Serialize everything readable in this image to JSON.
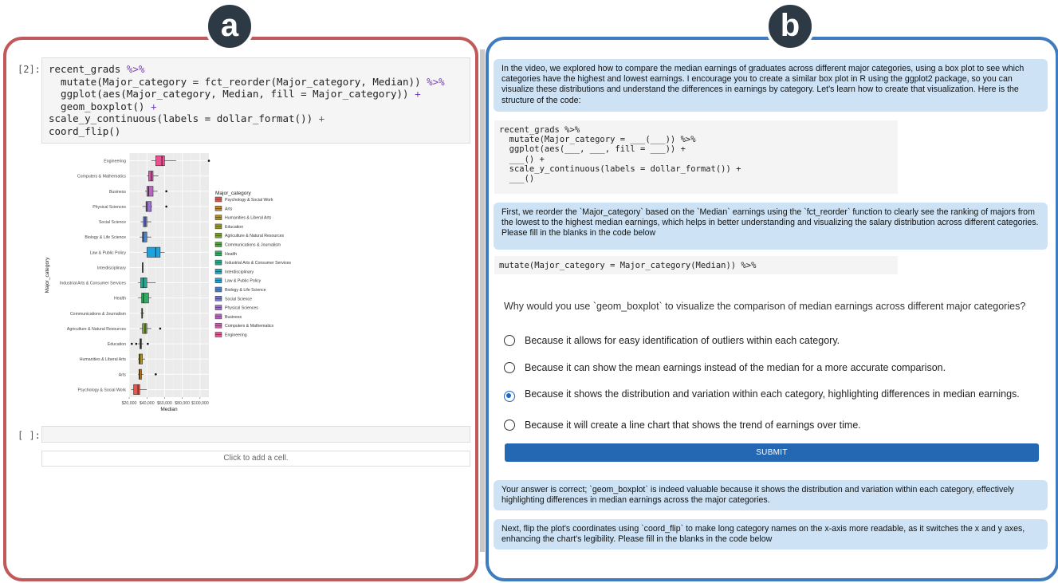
{
  "badges": {
    "a": "a",
    "b": "b"
  },
  "notebook": {
    "cell1_prompt": "[2]:",
    "cell1_lines": [
      {
        "text": "recent_grads ",
        "op": "%>%"
      },
      {
        "text": "  mutate(Major_category = fct_reorder(Major_category, Median)) ",
        "op": "%>%"
      },
      {
        "text": "  ggplot(aes(Major_category, Median, fill = Major_category)) ",
        "op": "+"
      },
      {
        "text": "  geom_boxplot() ",
        "op": "+"
      },
      {
        "text": "scale_y_continuous(labels = dollar_format()) ",
        "op": "+"
      },
      {
        "text": "coord_flip()",
        "op": ""
      }
    ],
    "cell2_prompt": "[ ]:",
    "add_cell_label": "Click to add a cell."
  },
  "chart_data": {
    "type": "box",
    "xlabel": "Median",
    "ylabel": "Major_category",
    "xlim": [
      20000,
      110000
    ],
    "x_ticks": [
      "$20,000",
      "$40,000",
      "$60,000",
      "$80,000",
      "$100,000"
    ],
    "x_tick_values": [
      20000,
      40000,
      60000,
      80000,
      100000
    ],
    "legend_title": "Major_category",
    "legend_position": "right",
    "grid": true,
    "categories": [
      {
        "name": "Engineering",
        "color": "#ee4f8f",
        "min": 45000,
        "q1": 50000,
        "median": 57000,
        "q3": 60000,
        "max": 73000,
        "outliers": [
          110000
        ]
      },
      {
        "name": "Computers & Mathematics",
        "color": "#d85bb0",
        "min": 40000,
        "q1": 42000,
        "median": 45000,
        "q3": 47000,
        "max": 53000,
        "outliers": []
      },
      {
        "name": "Business",
        "color": "#bf62c4",
        "min": 38000,
        "q1": 40000,
        "median": 42000,
        "q3": 47000,
        "max": 52000,
        "outliers": [
          62000
        ]
      },
      {
        "name": "Physical Sciences",
        "color": "#9c6ed3",
        "min": 35000,
        "q1": 39000,
        "median": 40000,
        "q3": 45000,
        "max": 46000,
        "outliers": [
          62000
        ]
      },
      {
        "name": "Social Science",
        "color": "#6f78d8",
        "min": 33000,
        "q1": 36000,
        "median": 38000,
        "q3": 40000,
        "max": 45000,
        "outliers": []
      },
      {
        "name": "Biology & Life Science",
        "color": "#4a84d4",
        "min": 32000,
        "q1": 35000,
        "median": 36000,
        "q3": 40000,
        "max": 45000,
        "outliers": []
      },
      {
        "name": "Law & Public Policy",
        "color": "#1fa3dc",
        "min": 36000,
        "q1": 40000,
        "median": 50000,
        "q3": 55000,
        "max": 60000,
        "outliers": []
      },
      {
        "name": "Interdisciplinary",
        "color": "#21a8bd",
        "min": 35000,
        "q1": 35000,
        "median": 35000,
        "q3": 35000,
        "max": 35000,
        "outliers": []
      },
      {
        "name": "Industrial Arts & Consumer Services",
        "color": "#1ead92",
        "min": 30000,
        "q1": 33000,
        "median": 36000,
        "q3": 40000,
        "max": 50000,
        "outliers": []
      },
      {
        "name": "Health",
        "color": "#2fae63",
        "min": 30000,
        "q1": 34000,
        "median": 36000,
        "q3": 42000,
        "max": 45000,
        "outliers": []
      },
      {
        "name": "Communications & Journalism",
        "color": "#4fa93a",
        "min": 33000,
        "q1": 34000,
        "median": 35000,
        "q3": 35000,
        "max": 37000,
        "outliers": []
      },
      {
        "name": "Agriculture & Natural Resources",
        "color": "#78a328",
        "min": 32000,
        "q1": 35000,
        "median": 38000,
        "q3": 40000,
        "max": 45000,
        "outliers": [
          55000
        ]
      },
      {
        "name": "Education",
        "color": "#939b1e",
        "min": 30000,
        "q1": 32000,
        "median": 33000,
        "q3": 34000,
        "max": 36000,
        "outliers": [
          23000,
          28000,
          41000
        ]
      },
      {
        "name": "Humanities & Liberal Arts",
        "color": "#ab9220",
        "min": 30000,
        "q1": 31000,
        "median": 32000,
        "q3": 35000,
        "max": 38000,
        "outliers": []
      },
      {
        "name": "Arts",
        "color": "#c48530",
        "min": 30000,
        "q1": 31000,
        "median": 32000,
        "q3": 34000,
        "max": 36000,
        "outliers": [
          50000
        ]
      },
      {
        "name": "Psychology & Social Work",
        "color": "#e2584f",
        "min": 22000,
        "q1": 25000,
        "median": 30000,
        "q3": 32000,
        "max": 40000,
        "outliers": []
      }
    ]
  },
  "chat": {
    "intro": "In the video, we explored how to compare the median earnings of graduates across different major categories, using a box plot to see which categories have the highest and lowest earnings. I encourage you to create a similar box plot in R using the ggplot2 package, so you can visualize these distributions and understand the differences in earnings by category. Let's learn how to create that visualization. Here is the structure of the code:",
    "code_template": "recent_grads %>%\n  mutate(Major_category = ___(___)) %>%\n  ggplot(aes(___, ___, fill = ___)) +\n  ___() +\n  scale_y_continuous(labels = dollar_format()) +\n  ___()",
    "step1": "First, we reorder the `Major_category` based on the `Median` earnings using the `fct_reorder` function to clearly see the ranking of majors from the lowest to the highest median earnings, which helps in better understanding and visualizing the salary distribution across different categories. Please fill in the blanks in the code below",
    "step1_code": "mutate(Major_category = Major_category(Median)) %>%",
    "question": "Why would you use `geom_boxplot` to visualize the comparison of median earnings across different major categories?",
    "options": [
      "Because it allows for easy identification of outliers within each category.",
      "Because it can show the mean earnings instead of the median for a more accurate comparison.",
      "Because it shows the distribution and variation within each category, highlighting differences in median earnings.",
      "Because it will create a line chart that shows the trend of earnings over time."
    ],
    "selected_option": 2,
    "submit_label": "SUBMIT",
    "feedback": "Your answer is correct; `geom_boxplot` is indeed valuable because it shows the distribution and variation within each category, effectively highlighting differences in median earnings across the major categories.",
    "step2": "Next, flip the plot's coordinates using `coord_flip` to make long category names on the x-axis more readable, as it switches the x and y axes, enhancing the chart's legibility. Please fill in the blanks in the code below"
  }
}
